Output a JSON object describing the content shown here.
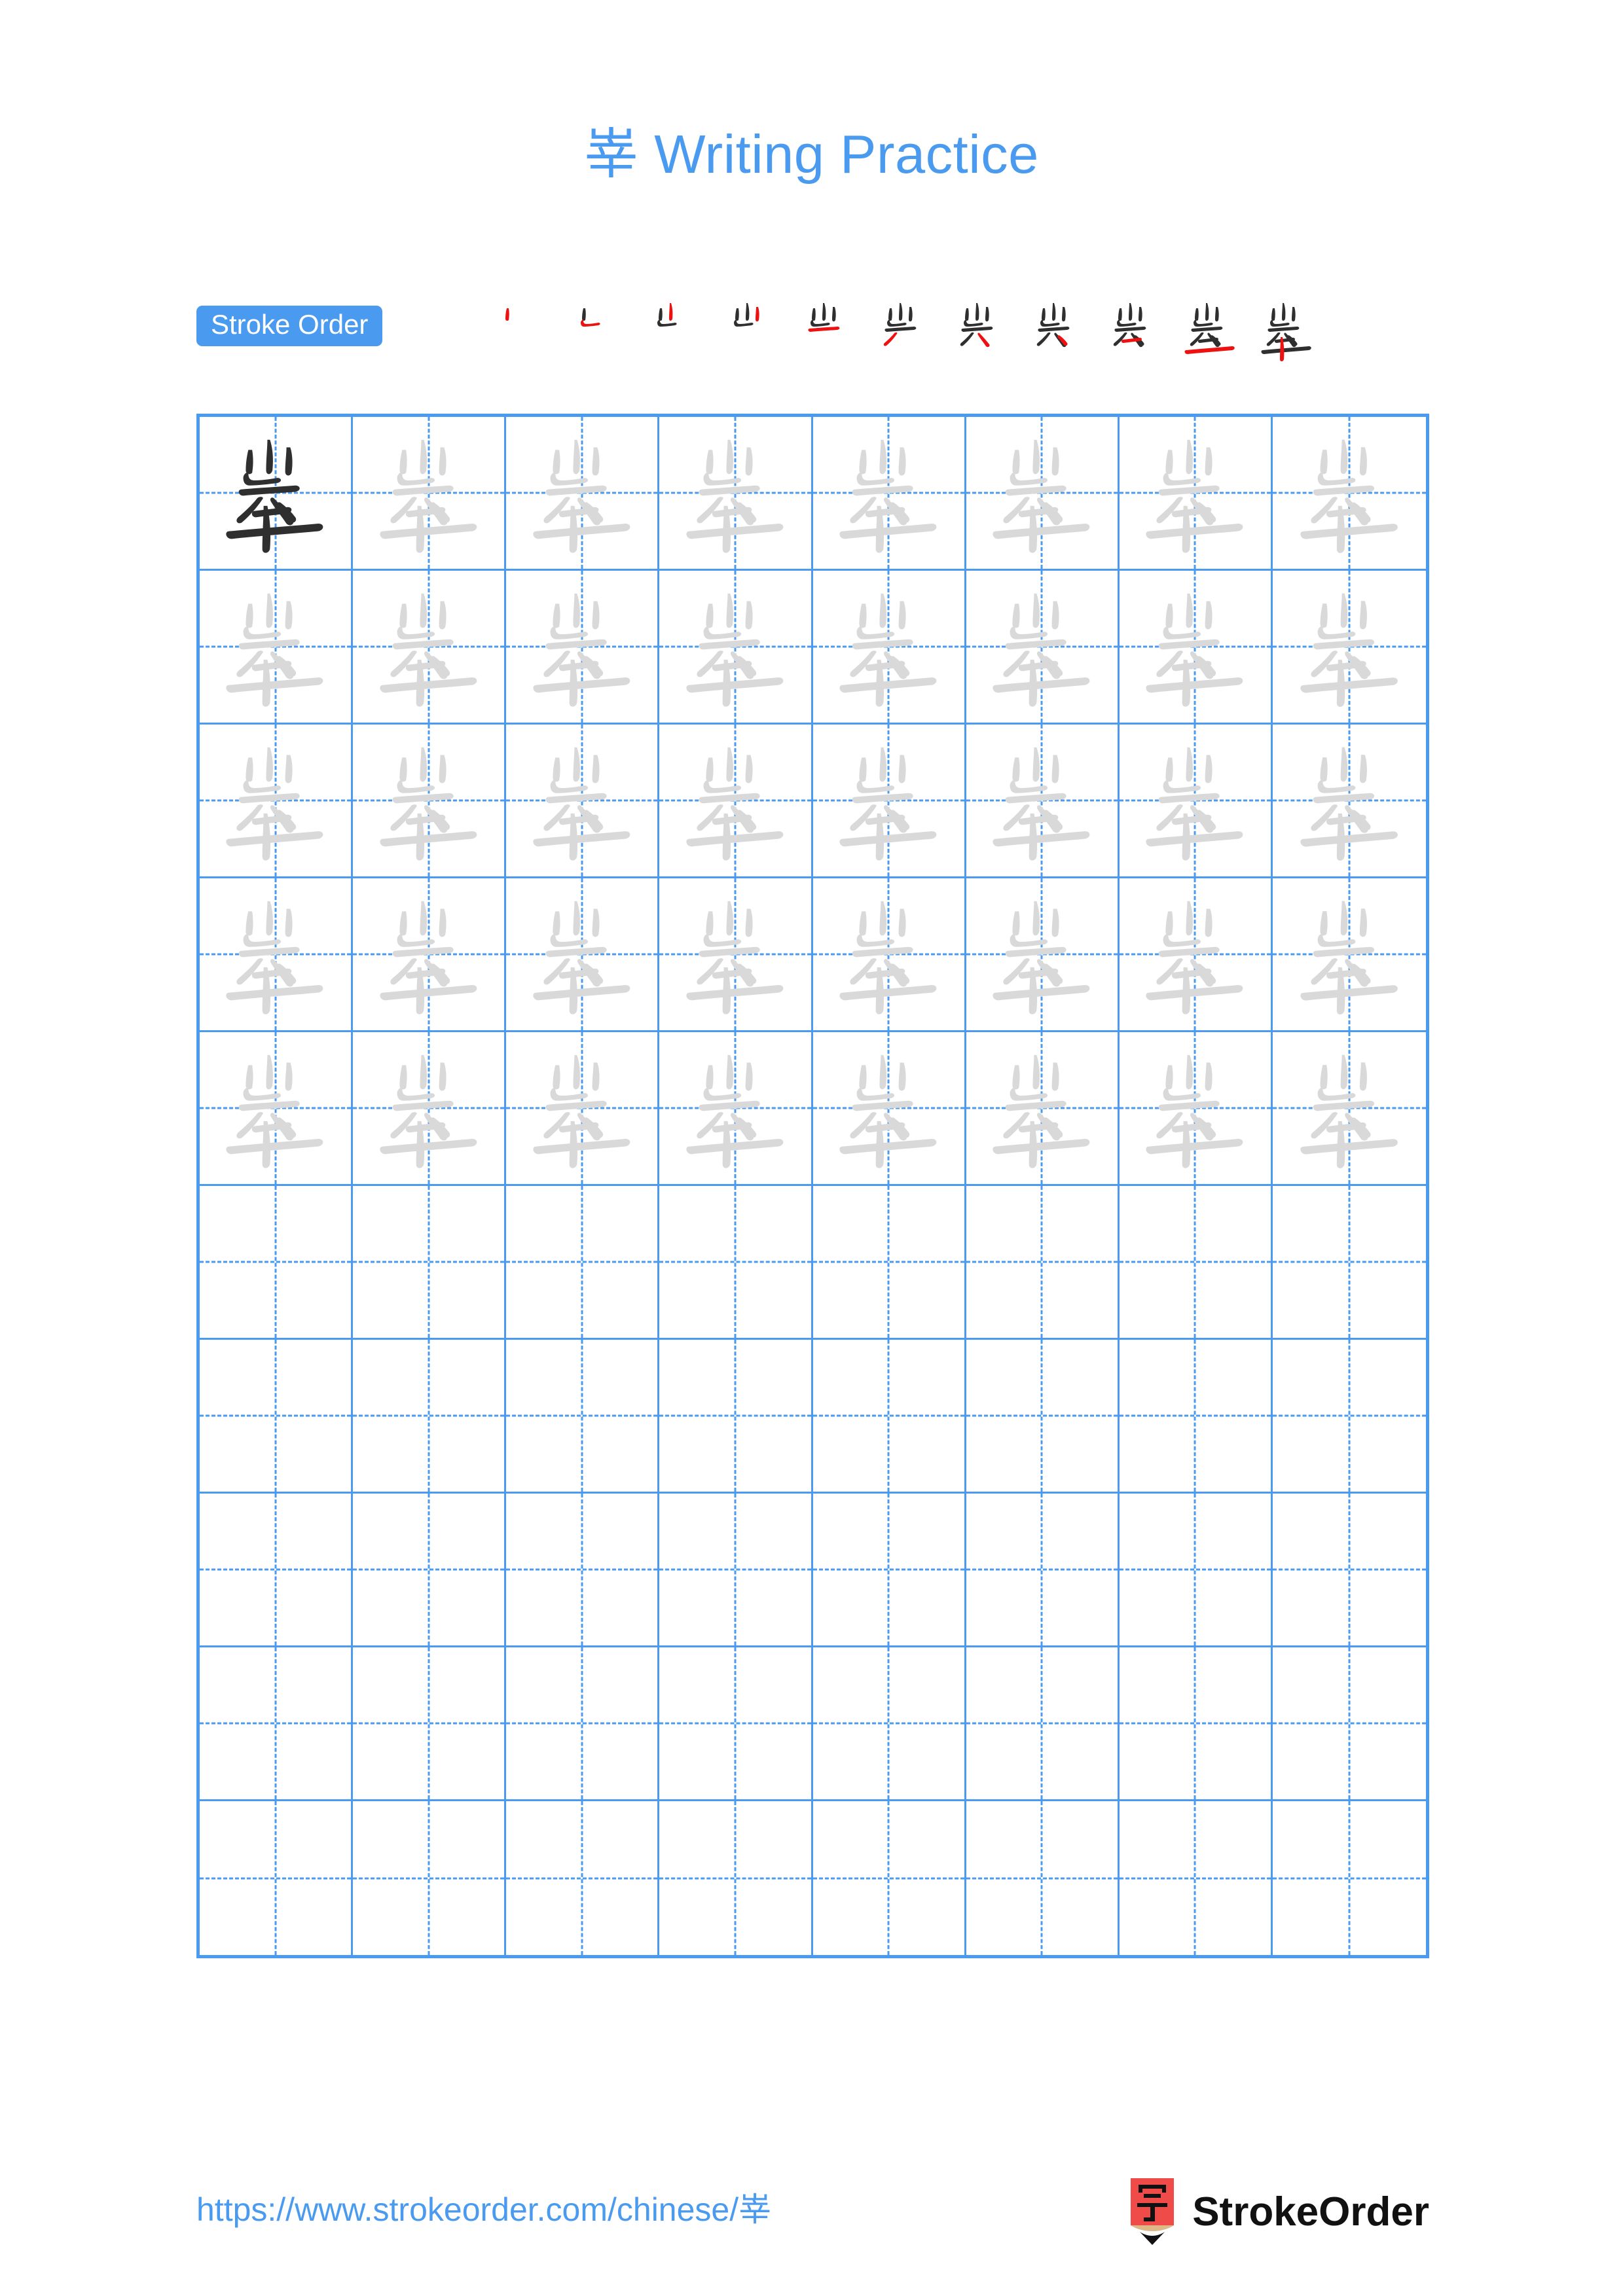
{
  "document": {
    "character": "峷",
    "title_suffix": " Writing Practice",
    "title_full": "峷 Writing Practice",
    "background_color": "#ffffff",
    "accent_color": "#4a9bf0",
    "highlight_stroke_color": "#ee1111",
    "ink_color": "#2f2f2f",
    "trace_color": "#d9d9d9"
  },
  "stroke_order": {
    "badge_label": "Stroke Order",
    "total_strokes": 11,
    "steps": [
      {
        "index": 1,
        "strokes_shown": 1,
        "new_stroke": 1
      },
      {
        "index": 2,
        "strokes_shown": 2,
        "new_stroke": 2
      },
      {
        "index": 3,
        "strokes_shown": 3,
        "new_stroke": 3
      },
      {
        "index": 4,
        "strokes_shown": 4,
        "new_stroke": 4
      },
      {
        "index": 5,
        "strokes_shown": 5,
        "new_stroke": 5
      },
      {
        "index": 6,
        "strokes_shown": 6,
        "new_stroke": 6
      },
      {
        "index": 7,
        "strokes_shown": 7,
        "new_stroke": 7
      },
      {
        "index": 8,
        "strokes_shown": 8,
        "new_stroke": 8
      },
      {
        "index": 9,
        "strokes_shown": 9,
        "new_stroke": 9
      },
      {
        "index": 10,
        "strokes_shown": 10,
        "new_stroke": 10
      },
      {
        "index": 11,
        "strokes_shown": 11,
        "new_stroke": 11
      }
    ]
  },
  "practice_grid": {
    "columns": 8,
    "rows": 10,
    "filled_rows": 5,
    "empty_rows": 5,
    "cells": [
      [
        "dark",
        "light",
        "light",
        "light",
        "light",
        "light",
        "light",
        "light"
      ],
      [
        "light",
        "light",
        "light",
        "light",
        "light",
        "light",
        "light",
        "light"
      ],
      [
        "light",
        "light",
        "light",
        "light",
        "light",
        "light",
        "light",
        "light"
      ],
      [
        "light",
        "light",
        "light",
        "light",
        "light",
        "light",
        "light",
        "light"
      ],
      [
        "light",
        "light",
        "light",
        "light",
        "light",
        "light",
        "light",
        "light"
      ],
      [
        "empty",
        "empty",
        "empty",
        "empty",
        "empty",
        "empty",
        "empty",
        "empty"
      ],
      [
        "empty",
        "empty",
        "empty",
        "empty",
        "empty",
        "empty",
        "empty",
        "empty"
      ],
      [
        "empty",
        "empty",
        "empty",
        "empty",
        "empty",
        "empty",
        "empty",
        "empty"
      ],
      [
        "empty",
        "empty",
        "empty",
        "empty",
        "empty",
        "empty",
        "empty",
        "empty"
      ],
      [
        "empty",
        "empty",
        "empty",
        "empty",
        "empty",
        "empty",
        "empty",
        "empty"
      ]
    ]
  },
  "footer": {
    "url": "https://www.strokeorder.com/chinese/峷",
    "brand_name": "StrokeOrder",
    "logo_glyph": "字",
    "logo_colors": {
      "body": "#ef4b48",
      "wood": "#deb887",
      "tip": "#111111"
    }
  }
}
